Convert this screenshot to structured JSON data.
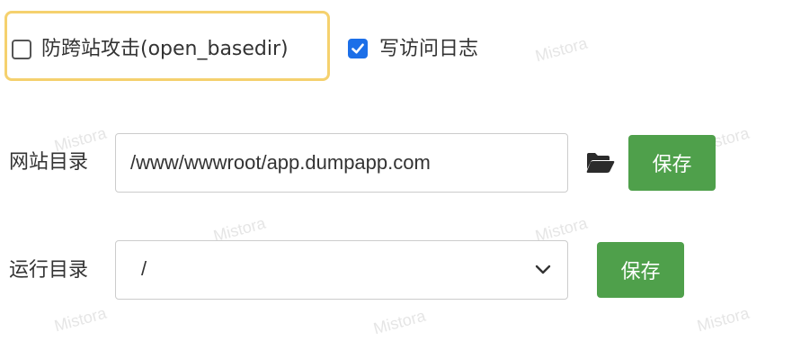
{
  "watermark": "Mistora",
  "options": {
    "open_basedir": {
      "label": "防跨站攻击(open_basedir)",
      "checked": false
    },
    "access_log": {
      "label": "写访问日志",
      "checked": true
    }
  },
  "site_dir": {
    "label": "网站目录",
    "value": "/www/wwwroot/app.dumpapp.com",
    "save_label": "保存"
  },
  "run_dir": {
    "label": "运行目录",
    "selected": "/",
    "save_label": "保存"
  },
  "colors": {
    "accent_blue": "#1c6fe8",
    "save_green": "#4fa04b",
    "highlight_yellow": "#f5d16e"
  },
  "icons": {
    "folder": "folder-open-icon",
    "chevron": "chevron-down-icon",
    "check": "check-icon"
  }
}
